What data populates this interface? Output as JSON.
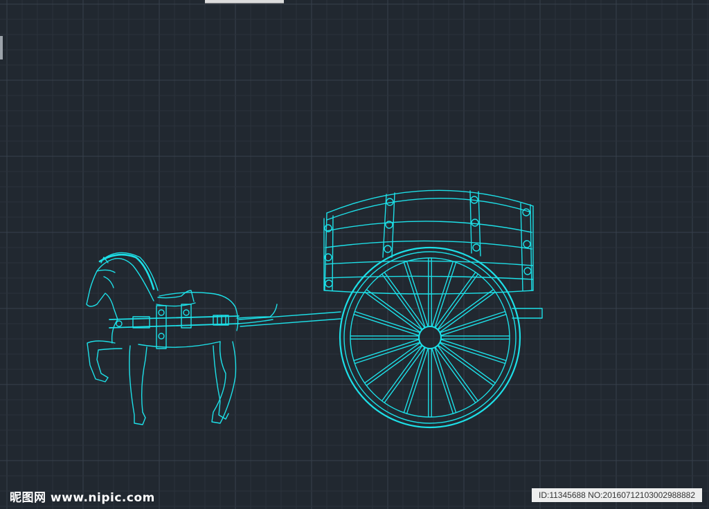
{
  "theme": {
    "background": "#212830",
    "grid_minor": "#2b323b",
    "grid_major": "#38414c",
    "stroke": "#1de0e8"
  },
  "watermark": {
    "brand": "昵图网",
    "url": "www.nipic.com",
    "id_text": "ID:11345688 NO:20160712103002988882"
  }
}
